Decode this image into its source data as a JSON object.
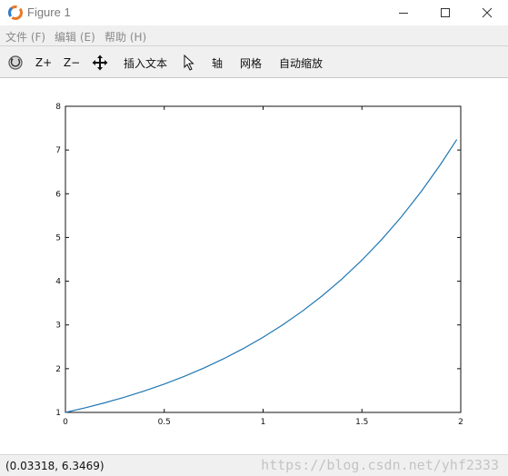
{
  "window": {
    "title": "Figure 1"
  },
  "menu": {
    "items": [
      {
        "label": "文件 (F)"
      },
      {
        "label": "编辑 (E)"
      },
      {
        "label": "帮助 (H)"
      }
    ]
  },
  "toolbar": {
    "zoom_in_label": "Z+",
    "zoom_out_label": "Z−",
    "insert_text_label": "插入文本",
    "axis_label": "轴",
    "grid_label": "网格",
    "autoscale_label": "自动缩放"
  },
  "status": {
    "coordinates": "(0.03318, 6.3469)",
    "watermark": "https://blog.csdn.net/yhf2333"
  },
  "colors": {
    "line": "#1f77b4",
    "chrome": "#f0f0f0"
  },
  "chart_data": {
    "type": "line",
    "title": "",
    "xlabel": "",
    "ylabel": "",
    "xlim": [
      0,
      2
    ],
    "ylim": [
      1,
      8
    ],
    "x_ticks": [
      0,
      0.5,
      1,
      1.5,
      2
    ],
    "y_ticks": [
      1,
      2,
      3,
      4,
      5,
      6,
      7,
      8
    ],
    "grid": false,
    "series": [
      {
        "x": [
          0,
          0.1,
          0.2,
          0.3,
          0.4,
          0.5,
          0.6,
          0.7,
          0.8,
          0.9,
          1.0,
          1.1,
          1.2,
          1.3,
          1.4,
          1.5,
          1.6,
          1.7,
          1.8,
          1.9,
          1.98
        ],
        "y": [
          1.0,
          1.105,
          1.221,
          1.35,
          1.492,
          1.649,
          1.822,
          2.014,
          2.226,
          2.46,
          2.718,
          3.004,
          3.32,
          3.669,
          4.055,
          4.482,
          4.953,
          5.474,
          6.05,
          6.686,
          7.24
        ]
      }
    ]
  }
}
